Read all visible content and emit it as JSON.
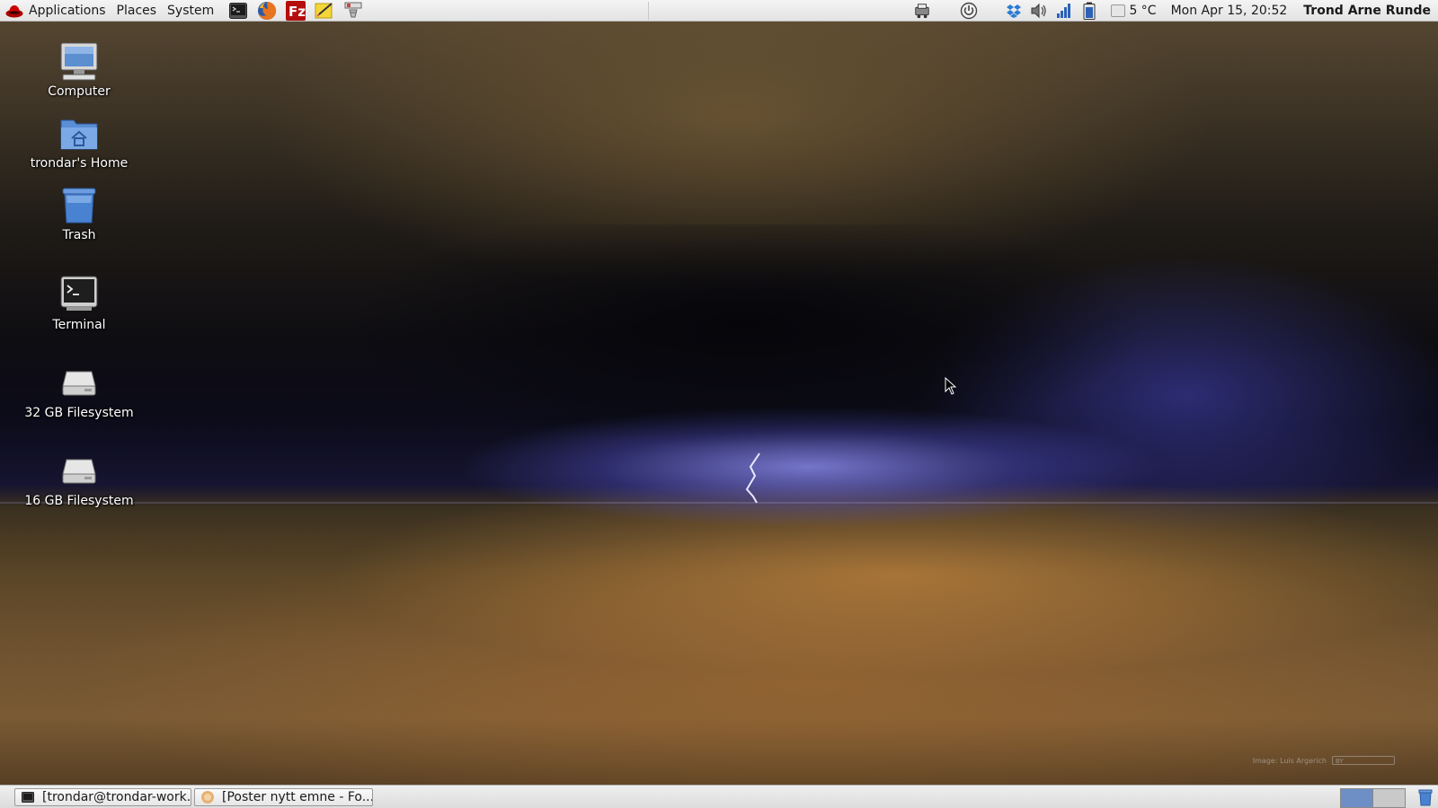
{
  "top_panel": {
    "menus": {
      "applications": "Applications",
      "places": "Places",
      "system": "System"
    },
    "launchers": [
      "terminal-icon",
      "firefox-icon",
      "filezilla-icon",
      "notes-icon",
      "network-monitor-icon"
    ],
    "tray": {
      "icons": [
        "printer-applet-icon",
        "power-icon",
        "dropbox-icon",
        "volume-icon",
        "signal-icon",
        "battery-icon"
      ],
      "weather": "5 °C",
      "clock": "Mon Apr 15, 20:52",
      "user": "Trond Arne Runde"
    }
  },
  "desktop": {
    "icons": [
      {
        "label": "Computer"
      },
      {
        "label": "trondar's Home"
      },
      {
        "label": "Trash"
      },
      {
        "label": "Terminal"
      },
      {
        "label": "32 GB Filesystem"
      },
      {
        "label": "16 GB Filesystem"
      }
    ],
    "wallpaper_credit": "Image: Luis Argerich",
    "cc_badge": "BY"
  },
  "bottom_panel": {
    "tasks": [
      {
        "label": "[trondar@trondar-work..."
      },
      {
        "label": "[Poster nytt emne - Fo..."
      }
    ],
    "workspaces": [
      "active",
      "inactive"
    ]
  },
  "colors": {
    "panel_bg": "#e8e8e8",
    "workspace_active": "#6d8fc6",
    "desktop_label": "#ffffff",
    "lightning": "#c8c8ff"
  }
}
